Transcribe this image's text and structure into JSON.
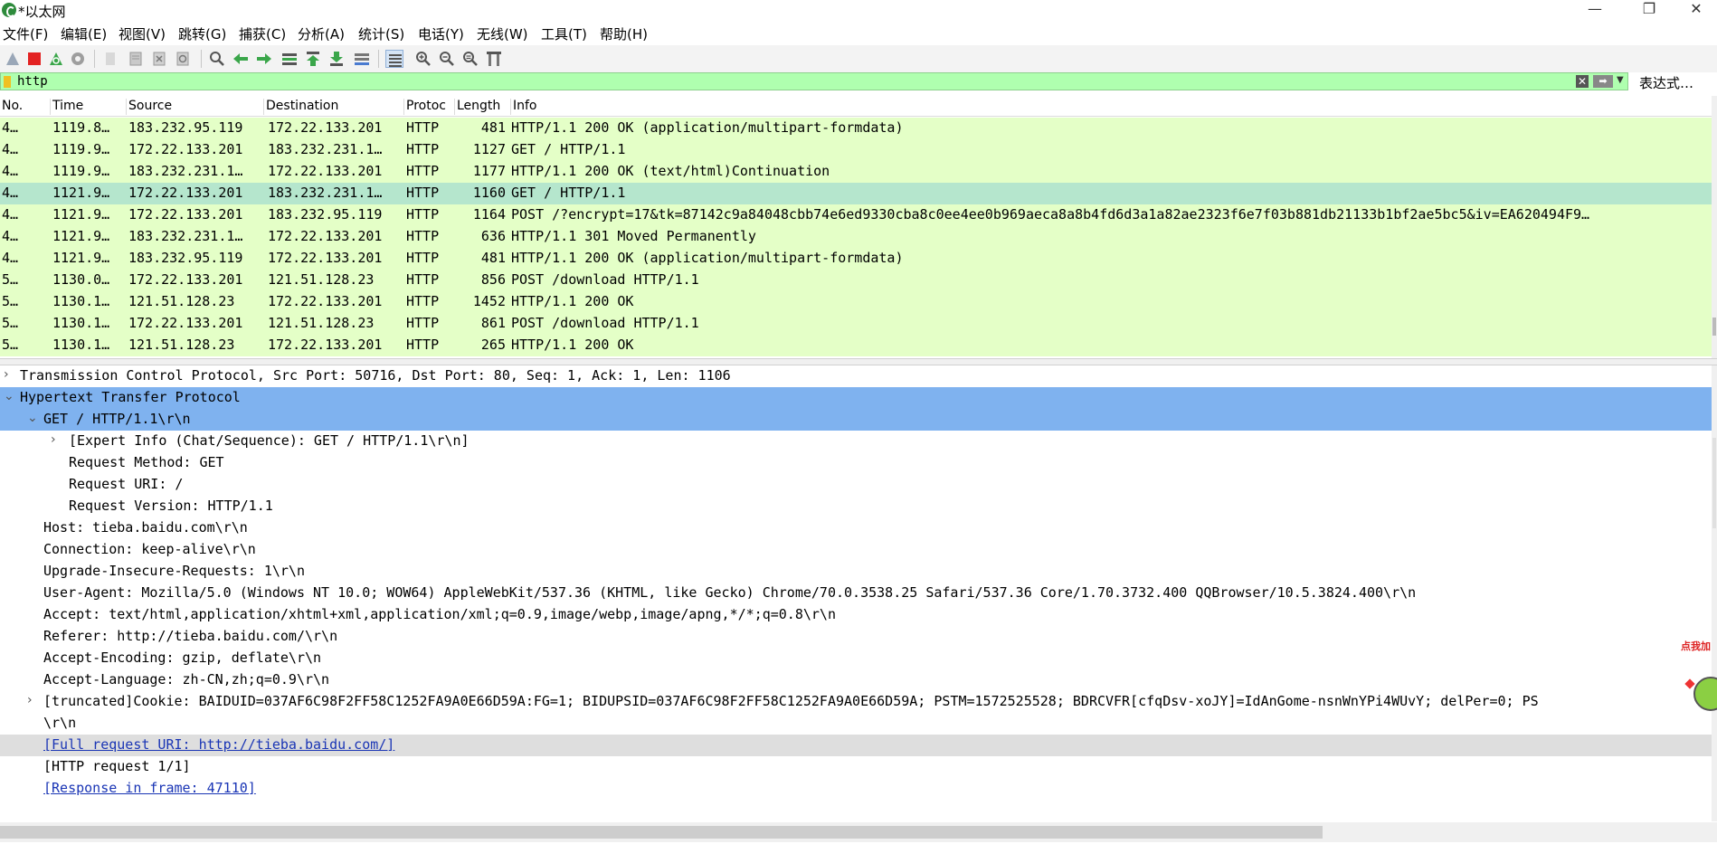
{
  "window": {
    "title": "*以太网",
    "minimize_glyph": "—",
    "restore_glyph": "❐",
    "close_glyph": "✕"
  },
  "menu": [
    "文件(F)",
    "编辑(E)",
    "视图(V)",
    "跳转(G)",
    "捕获(C)",
    "分析(A)",
    "统计(S)",
    "电话(Y)",
    "无线(W)",
    "工具(T)",
    "帮助(H)"
  ],
  "toolbar": {
    "icons": [
      "start-capture-icon",
      "stop-capture-icon",
      "restart-capture-icon",
      "capture-options-icon",
      "open-file-icon",
      "save-file-icon",
      "close-file-icon",
      "reload-file-icon",
      "find-packet-icon",
      "go-back-icon",
      "go-forward-icon",
      "go-to-packet-icon",
      "go-first-icon",
      "go-last-icon",
      "auto-scroll-icon",
      "colorize-icon",
      "zoom-in-icon",
      "zoom-out-icon",
      "zoom-normal-icon",
      "resize-columns-icon"
    ]
  },
  "filter": {
    "value": "http",
    "expression_label": "表达式…"
  },
  "columns": [
    "No.",
    "Time",
    "Source",
    "Destination",
    "Protoc",
    "Length",
    "Info"
  ],
  "packets": [
    {
      "no": "4…",
      "time": "1119.8…",
      "source": "183.232.95.119",
      "destination": "172.22.133.201",
      "protocol": "HTTP",
      "length": "481",
      "info": "HTTP/1.1 200 OK  (application/multipart-formdata)",
      "selected": false
    },
    {
      "no": "4…",
      "time": "1119.9…",
      "source": "172.22.133.201",
      "destination": "183.232.231.1…",
      "protocol": "HTTP",
      "length": "1127",
      "info": "GET / HTTP/1.1",
      "selected": false
    },
    {
      "no": "4…",
      "time": "1119.9…",
      "source": "183.232.231.1…",
      "destination": "172.22.133.201",
      "protocol": "HTTP",
      "length": "1177",
      "info": "HTTP/1.1 200 OK  (text/html)Continuation",
      "selected": false
    },
    {
      "no": "4…",
      "time": "1121.9…",
      "source": "172.22.133.201",
      "destination": "183.232.231.1…",
      "protocol": "HTTP",
      "length": "1160",
      "info": "GET / HTTP/1.1",
      "selected": true
    },
    {
      "no": "4…",
      "time": "1121.9…",
      "source": "172.22.133.201",
      "destination": "183.232.95.119",
      "protocol": "HTTP",
      "length": "1164",
      "info": "POST /?encrypt=17&tk=87142c9a84048cbb74e6ed9330cba8c0ee4ee0b969aeca8a8b4fd6d3a1a82ae2323f6e7f03b881db21133b1bf2ae5bc5&iv=EA620494F9…",
      "selected": false
    },
    {
      "no": "4…",
      "time": "1121.9…",
      "source": "183.232.231.1…",
      "destination": "172.22.133.201",
      "protocol": "HTTP",
      "length": "636",
      "info": "HTTP/1.1 301 Moved Permanently",
      "selected": false
    },
    {
      "no": "4…",
      "time": "1121.9…",
      "source": "183.232.95.119",
      "destination": "172.22.133.201",
      "protocol": "HTTP",
      "length": "481",
      "info": "HTTP/1.1 200 OK  (application/multipart-formdata)",
      "selected": false
    },
    {
      "no": "5…",
      "time": "1130.0…",
      "source": "172.22.133.201",
      "destination": "121.51.128.23",
      "protocol": "HTTP",
      "length": "856",
      "info": "POST /download HTTP/1.1",
      "selected": false
    },
    {
      "no": "5…",
      "time": "1130.1…",
      "source": "121.51.128.23",
      "destination": "172.22.133.201",
      "protocol": "HTTP",
      "length": "1452",
      "info": "HTTP/1.1 200 OK",
      "selected": false
    },
    {
      "no": "5…",
      "time": "1130.1…",
      "source": "172.22.133.201",
      "destination": "121.51.128.23",
      "protocol": "HTTP",
      "length": "861",
      "info": "POST /download HTTP/1.1",
      "selected": false
    },
    {
      "no": "5…",
      "time": "1130.1…",
      "source": "121.51.128.23",
      "destination": "172.22.133.201",
      "protocol": "HTTP",
      "length": "265",
      "info": "HTTP/1.1 200 OK",
      "selected": false
    }
  ],
  "details": [
    {
      "text": "Transmission Control Protocol, Src Port: 50716, Dst Port: 80, Seq: 1, Ack: 1, Len: 1106",
      "level": 0,
      "arrow": "collapsed",
      "style": "",
      "link": false
    },
    {
      "text": "Hypertext Transfer Protocol",
      "level": 0,
      "arrow": "expanded",
      "style": "hl",
      "link": false
    },
    {
      "text": "GET / HTTP/1.1\\r\\n",
      "level": 1,
      "arrow": "expanded",
      "style": "hl",
      "link": false
    },
    {
      "text": "[Expert Info (Chat/Sequence): GET / HTTP/1.1\\r\\n]",
      "level": 2,
      "arrow": "collapsed",
      "style": "",
      "link": false
    },
    {
      "text": "Request Method: GET",
      "level": 2,
      "arrow": "none",
      "style": "",
      "link": false
    },
    {
      "text": "Request URI: /",
      "level": 2,
      "arrow": "none",
      "style": "",
      "link": false
    },
    {
      "text": "Request Version: HTTP/1.1",
      "level": 2,
      "arrow": "none",
      "style": "",
      "link": false
    },
    {
      "text": "Host: tieba.baidu.com\\r\\n",
      "level": 1,
      "arrow": "none",
      "style": "",
      "link": false
    },
    {
      "text": "Connection: keep-alive\\r\\n",
      "level": 1,
      "arrow": "none",
      "style": "",
      "link": false
    },
    {
      "text": "Upgrade-Insecure-Requests: 1\\r\\n",
      "level": 1,
      "arrow": "none",
      "style": "",
      "link": false
    },
    {
      "text": "User-Agent: Mozilla/5.0 (Windows NT 10.0; WOW64) AppleWebKit/537.36 (KHTML, like Gecko) Chrome/70.0.3538.25 Safari/537.36 Core/1.70.3732.400 QQBrowser/10.5.3824.400\\r\\n",
      "level": 1,
      "arrow": "none",
      "style": "",
      "link": false
    },
    {
      "text": "Accept: text/html,application/xhtml+xml,application/xml;q=0.9,image/webp,image/apng,*/*;q=0.8\\r\\n",
      "level": 1,
      "arrow": "none",
      "style": "",
      "link": false
    },
    {
      "text": "Referer: http://tieba.baidu.com/\\r\\n",
      "level": 1,
      "arrow": "none",
      "style": "",
      "link": false
    },
    {
      "text": "Accept-Encoding: gzip, deflate\\r\\n",
      "level": 1,
      "arrow": "none",
      "style": "",
      "link": false
    },
    {
      "text": "Accept-Language: zh-CN,zh;q=0.9\\r\\n",
      "level": 1,
      "arrow": "none",
      "style": "",
      "link": false
    },
    {
      "text": " [truncated]Cookie: BAIDUID=037AF6C98F2FF58C1252FA9A0E66D59A:FG=1; BIDUPSID=037AF6C98F2FF58C1252FA9A0E66D59A; PSTM=1572525528; BDRCVFR[cfqDsv-xoJY]=IdAnGome-nsnWnYPi4WUvY; delPer=0; PS",
      "level": 1,
      "arrow": "collapsed",
      "style": "",
      "link": false
    },
    {
      "text": "\\r\\n",
      "level": 1,
      "arrow": "none",
      "style": "",
      "link": false
    },
    {
      "text": "[Full request URI: http://tieba.baidu.com/]",
      "level": 1,
      "arrow": "none",
      "style": "gray",
      "link": true
    },
    {
      "text": "[HTTP request 1/1]",
      "level": 1,
      "arrow": "none",
      "style": "",
      "link": false
    },
    {
      "text": "[Response in frame: 47110]",
      "level": 1,
      "arrow": "none",
      "style": "",
      "link": true
    }
  ],
  "floater_label": "点我加"
}
